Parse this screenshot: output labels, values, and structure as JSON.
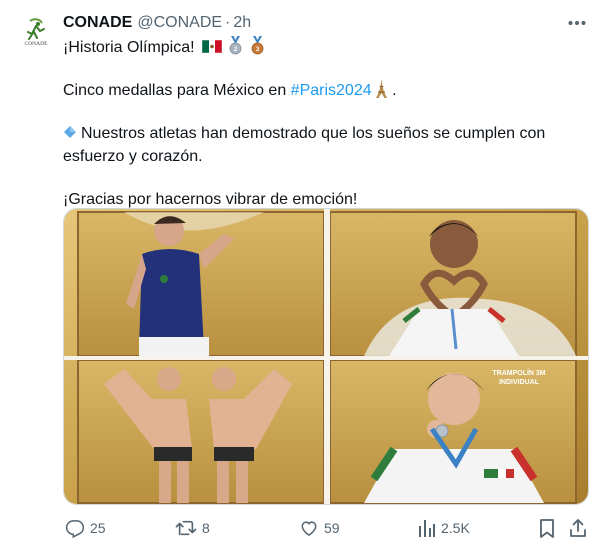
{
  "tweet": {
    "display_name": "CONADE",
    "handle": "@CONADE",
    "separator": "·",
    "time": "2h",
    "line1": "¡Historia Olímpica!",
    "line2_before": "Cinco medallas para México en ",
    "line2_hashtag": "#Paris2024",
    "line2_after": " .",
    "line3": "Nuestros atletas han demostrado que los sueños se cumplen con esfuerzo y corazón.",
    "line4": "¡Gracias por hacernos vibrar de emoción!"
  },
  "avatar": {
    "logo_text": "CONADE"
  },
  "media": {
    "panel_4_caption_line1": "TRAMPOLÍN 3M",
    "panel_4_caption_line2": "INDIVIDUAL"
  },
  "actions": {
    "replies": "25",
    "reposts": "8",
    "likes": "59",
    "views": "2.5K"
  },
  "colors": {
    "accent": "#1d9bf0",
    "secondary_text": "#536471",
    "frame_gold": "#c9a14a",
    "silver": "#a9b4bf",
    "bronze": "#c77a3a"
  },
  "icons": [
    "more-icon",
    "reply-icon",
    "repost-icon",
    "like-icon",
    "views-icon",
    "bookmark-icon",
    "share-icon"
  ]
}
